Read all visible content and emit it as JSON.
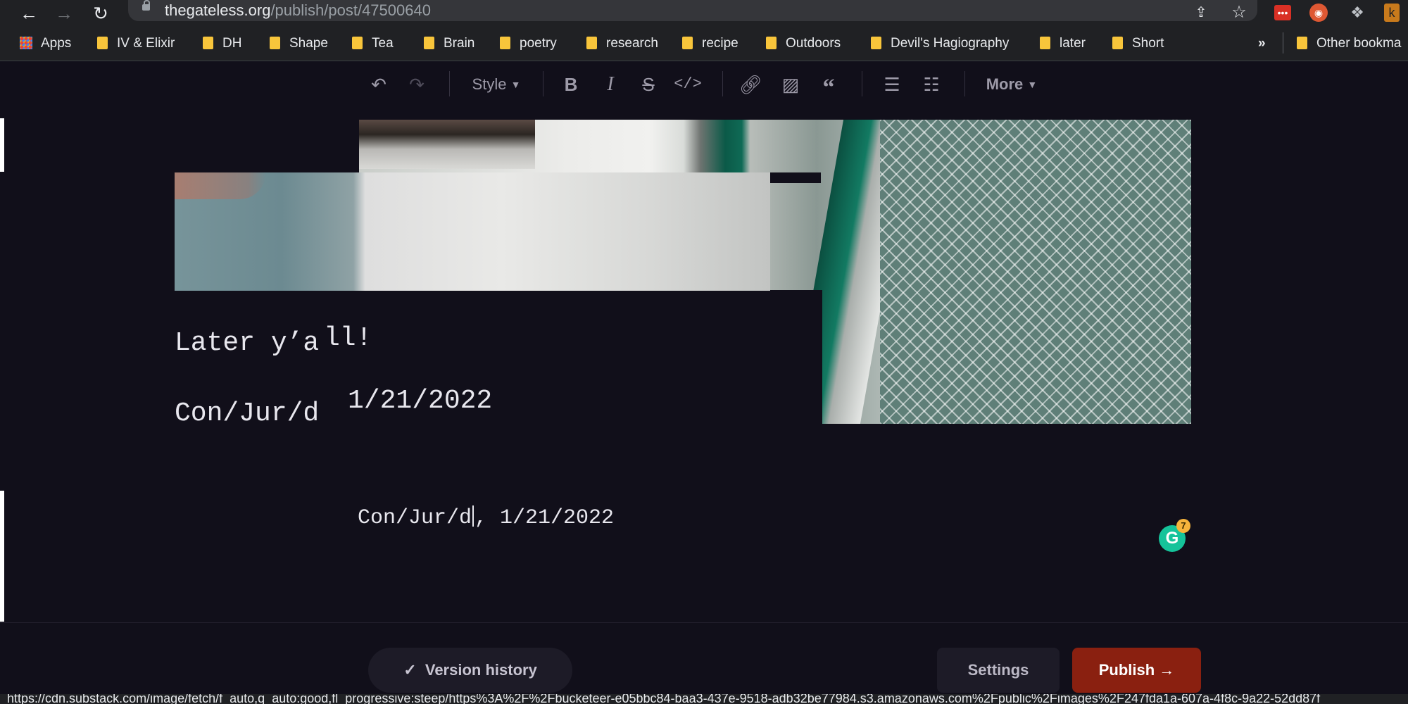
{
  "browser": {
    "url_domain": "thegateless.org",
    "url_path": "/publish/post/47500640",
    "back_icon": "arrow-left-icon",
    "forward_icon": "arrow-right-icon",
    "reload_icon": "reload-icon"
  },
  "bookmarks": [
    {
      "label": "Apps",
      "icon": "apps-grid-icon"
    },
    {
      "label": "IV & Elixir"
    },
    {
      "label": "DH"
    },
    {
      "label": "Shape"
    },
    {
      "label": "Tea"
    },
    {
      "label": "Brain"
    },
    {
      "label": "poetry"
    },
    {
      "label": "research"
    },
    {
      "label": "recipe"
    },
    {
      "label": "Outdoors"
    },
    {
      "label": "Devil's Hagiography"
    },
    {
      "label": "later"
    },
    {
      "label": "Short"
    }
  ],
  "bookmarks_overflow": "»",
  "other_bookmarks": "Other bookma",
  "editor_toolbar": {
    "style_label": "Style",
    "more_label": "More"
  },
  "content": {
    "line1_a": "Later y’a",
    "line1_b": "ll!",
    "line2_a": "Con/Jur/d",
    "line2_date": "1/21/2022",
    "line3_a": "Con/Jur/d",
    "line3_b": ", 1/21/2022"
  },
  "grammarly_count": "7",
  "footer": {
    "version_history": "Version history",
    "settings": "Settings",
    "publish": "Publish"
  },
  "status_url": "https://cdn.substack.com/image/fetch/f_auto,q_auto:good,fl_progressive:steep/https%3A%2F%2Fbucketeer-e05bbc84-baa3-437e-9518-adb32be77984.s3.amazonaws.com%2Fpublic%2Fimages%2F247fda1a-607a-4f8c-9a22-52dd87f"
}
